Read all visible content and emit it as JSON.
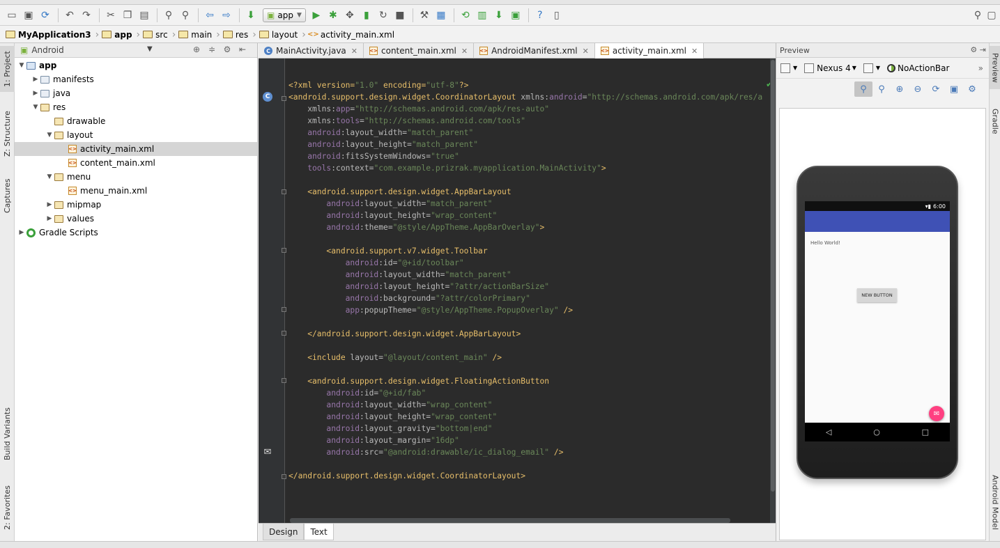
{
  "toolbar": {
    "run_config": "app",
    "icons": [
      "open-icon",
      "save-icon",
      "sync-icon",
      "undo-icon",
      "redo-icon",
      "cut-icon",
      "copy-icon",
      "paste-icon",
      "find-icon",
      "replace-icon",
      "back-icon",
      "forward-icon",
      "build-icon",
      "run-icon",
      "debug-icon",
      "attach-icon",
      "coverage-icon",
      "stop-icon",
      "settings-icon",
      "structure-icon",
      "sdk-icon",
      "avd-icon",
      "gradle-sync-icon",
      "android-device-icon",
      "help-icon",
      "monitor-icon"
    ]
  },
  "breadcrumbs": [
    "MyApplication3",
    "app",
    "src",
    "main",
    "res",
    "layout",
    "activity_main.xml"
  ],
  "left_strip": {
    "project": "1: Project",
    "structure": "Z: Structure",
    "captures": "Captures",
    "build_variants": "Build Variants",
    "favorites": "2: Favorites"
  },
  "right_strip": {
    "preview": "Preview",
    "gradle": "Gradle",
    "android_model": "Android Model"
  },
  "project": {
    "view": "Android",
    "tree": [
      {
        "label": "app",
        "indent": 0,
        "twisty": "▼",
        "icon": "mod"
      },
      {
        "label": "manifests",
        "indent": 1,
        "twisty": "▶",
        "icon": "fold"
      },
      {
        "label": "java",
        "indent": 1,
        "twisty": "▶",
        "icon": "fold"
      },
      {
        "label": "res",
        "indent": 1,
        "twisty": "▼",
        "icon": "res"
      },
      {
        "label": "drawable",
        "indent": 2,
        "twisty": "",
        "icon": "res"
      },
      {
        "label": "layout",
        "indent": 2,
        "twisty": "▼",
        "icon": "res"
      },
      {
        "label": "activity_main.xml",
        "indent": 3,
        "twisty": "",
        "icon": "xml",
        "selected": true
      },
      {
        "label": "content_main.xml",
        "indent": 3,
        "twisty": "",
        "icon": "xml"
      },
      {
        "label": "menu",
        "indent": 2,
        "twisty": "▼",
        "icon": "res"
      },
      {
        "label": "menu_main.xml",
        "indent": 3,
        "twisty": "",
        "icon": "xml"
      },
      {
        "label": "mipmap",
        "indent": 2,
        "twisty": "▶",
        "icon": "res"
      },
      {
        "label": "values",
        "indent": 2,
        "twisty": "▶",
        "icon": "res"
      },
      {
        "label": "Gradle Scripts",
        "indent": 0,
        "twisty": "▶",
        "icon": "gradle"
      }
    ]
  },
  "editor_tabs": [
    {
      "label": "MainActivity.java",
      "icon": "c",
      "active": false
    },
    {
      "label": "content_main.xml",
      "icon": "xml",
      "active": false
    },
    {
      "label": "AndroidManifest.xml",
      "icon": "xml",
      "active": false
    },
    {
      "label": "activity_main.xml",
      "icon": "xml",
      "active": true
    }
  ],
  "code_lines": [
    [
      [
        "p",
        "<?xml version="
      ],
      [
        "v",
        "\"1.0\""
      ],
      [
        "p",
        " encoding="
      ],
      [
        "v",
        "\"utf-8\""
      ],
      [
        "p",
        "?>"
      ]
    ],
    [
      [
        "t",
        "<android.support.design.widget.CoordinatorLayout "
      ],
      [
        "a",
        "xmlns:"
      ],
      [
        "an",
        "android"
      ],
      [
        "a",
        "="
      ],
      [
        "v",
        "\"http://schemas.android.com/apk/res/a"
      ]
    ],
    [
      [
        "a",
        "    xmlns:"
      ],
      [
        "an",
        "app"
      ],
      [
        "a",
        "="
      ],
      [
        "v",
        "\"http://schemas.android.com/apk/res-auto\""
      ]
    ],
    [
      [
        "a",
        "    xmlns:"
      ],
      [
        "an",
        "tools"
      ],
      [
        "a",
        "="
      ],
      [
        "v",
        "\"http://schemas.android.com/tools\""
      ]
    ],
    [
      [
        "an",
        "    android"
      ],
      [
        "a",
        ":layout_width="
      ],
      [
        "v",
        "\"match_parent\""
      ]
    ],
    [
      [
        "an",
        "    android"
      ],
      [
        "a",
        ":layout_height="
      ],
      [
        "v",
        "\"match_parent\""
      ]
    ],
    [
      [
        "an",
        "    android"
      ],
      [
        "a",
        ":fitsSystemWindows="
      ],
      [
        "v",
        "\"true\""
      ]
    ],
    [
      [
        "an",
        "    tools"
      ],
      [
        "a",
        ":context="
      ],
      [
        "v",
        "\"com.example.prizrak.myapplication.MainActivity\""
      ],
      [
        "t",
        ">"
      ]
    ],
    [],
    [
      [
        "t",
        "    <android.support.design.widget.AppBarLayout"
      ]
    ],
    [
      [
        "an",
        "        android"
      ],
      [
        "a",
        ":layout_width="
      ],
      [
        "v",
        "\"match_parent\""
      ]
    ],
    [
      [
        "an",
        "        android"
      ],
      [
        "a",
        ":layout_height="
      ],
      [
        "v",
        "\"wrap_content\""
      ]
    ],
    [
      [
        "an",
        "        android"
      ],
      [
        "a",
        ":theme="
      ],
      [
        "v",
        "\"@style/AppTheme.AppBarOverlay\""
      ],
      [
        "t",
        ">"
      ]
    ],
    [],
    [
      [
        "t",
        "        <android.support.v7.widget.Toolbar"
      ]
    ],
    [
      [
        "an",
        "            android"
      ],
      [
        "a",
        ":id="
      ],
      [
        "v",
        "\"@+id/toolbar\""
      ]
    ],
    [
      [
        "an",
        "            android"
      ],
      [
        "a",
        ":layout_width="
      ],
      [
        "v",
        "\"match_parent\""
      ]
    ],
    [
      [
        "an",
        "            android"
      ],
      [
        "a",
        ":layout_height="
      ],
      [
        "v",
        "\"?attr/actionBarSize\""
      ]
    ],
    [
      [
        "an",
        "            android"
      ],
      [
        "a",
        ":background="
      ],
      [
        "v",
        "\"?attr/colorPrimary\""
      ]
    ],
    [
      [
        "an",
        "            app"
      ],
      [
        "a",
        ":popupTheme="
      ],
      [
        "v",
        "\"@style/AppTheme.PopupOverlay\""
      ],
      [
        "t",
        " />"
      ]
    ],
    [],
    [
      [
        "t",
        "    </android.support.design.widget.AppBarLayout>"
      ]
    ],
    [],
    [
      [
        "t",
        "    <include "
      ],
      [
        "a",
        "layout="
      ],
      [
        "v",
        "\"@layout/content_main\""
      ],
      [
        "t",
        " />"
      ]
    ],
    [],
    [
      [
        "t",
        "    <android.support.design.widget.FloatingActionButton"
      ]
    ],
    [
      [
        "an",
        "        android"
      ],
      [
        "a",
        ":id="
      ],
      [
        "v",
        "\"@+id/fab\""
      ]
    ],
    [
      [
        "an",
        "        android"
      ],
      [
        "a",
        ":layout_width="
      ],
      [
        "v",
        "\"wrap_content\""
      ]
    ],
    [
      [
        "an",
        "        android"
      ],
      [
        "a",
        ":layout_height="
      ],
      [
        "v",
        "\"wrap_content\""
      ]
    ],
    [
      [
        "an",
        "        android"
      ],
      [
        "a",
        ":layout_gravity="
      ],
      [
        "v",
        "\"bottom|end\""
      ]
    ],
    [
      [
        "an",
        "        android"
      ],
      [
        "a",
        ":layout_margin="
      ],
      [
        "v",
        "\"16dp\""
      ]
    ],
    [
      [
        "an",
        "        android"
      ],
      [
        "a",
        ":src="
      ],
      [
        "v",
        "\"@android:drawable/ic_dialog_email\""
      ],
      [
        "t",
        " />"
      ]
    ],
    [],
    [
      [
        "t",
        "</android.support.design.widget.CoordinatorLayout>"
      ]
    ]
  ],
  "bottom_tabs": [
    {
      "label": "Design",
      "active": false
    },
    {
      "label": "Text",
      "active": true
    }
  ],
  "preview": {
    "title": "Preview",
    "device": "Nexus 4",
    "theme": "NoActionBar",
    "time": "6:00",
    "hello_text": "Hello World!",
    "button_text": "NEW BUTTON",
    "colors": {
      "app_bar": "#3f51b5",
      "fab": "#ff4081"
    }
  }
}
